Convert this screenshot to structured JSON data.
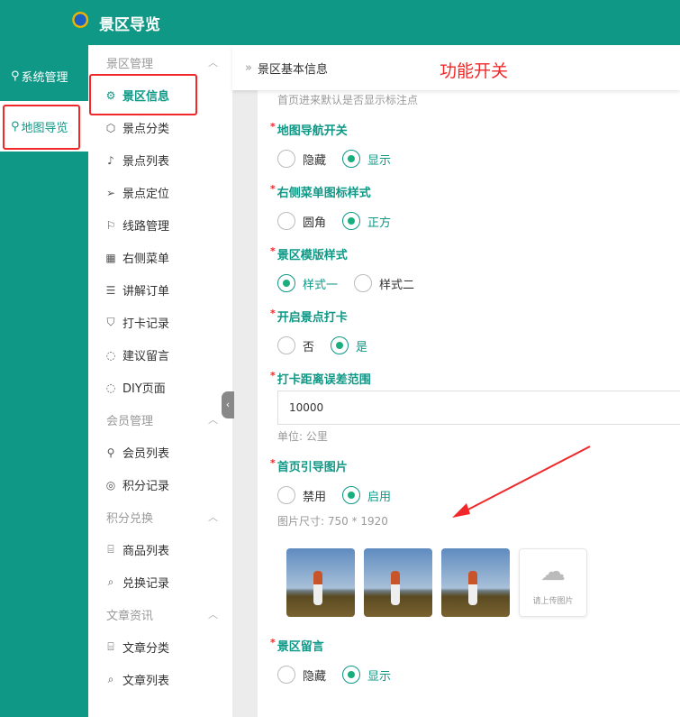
{
  "header": {
    "title": "景区导览"
  },
  "sidebar_main": {
    "items": [
      {
        "label": "系统管理",
        "icon": "user-icon"
      },
      {
        "label": "地图导览",
        "icon": "user-icon",
        "active": true
      }
    ]
  },
  "sidebar_sub": {
    "groups": [
      {
        "label": "景区管理",
        "items": [
          {
            "label": "景区信息",
            "icon": "gear-icon",
            "active": true
          },
          {
            "label": "景点分类",
            "icon": "cube-icon"
          },
          {
            "label": "景点列表",
            "icon": "music-note-icon"
          },
          {
            "label": "景点定位",
            "icon": "send-icon"
          },
          {
            "label": "线路管理",
            "icon": "flag-icon"
          },
          {
            "label": "右侧菜单",
            "icon": "grid-icon"
          },
          {
            "label": "讲解订单",
            "icon": "list-icon"
          },
          {
            "label": "打卡记录",
            "icon": "shield-icon"
          },
          {
            "label": "建议留言",
            "icon": "message-icon"
          },
          {
            "label": "DIY页面",
            "icon": "message-icon"
          }
        ]
      },
      {
        "label": "会员管理",
        "items": [
          {
            "label": "会员列表",
            "icon": "user-icon"
          },
          {
            "label": "积分记录",
            "icon": "medal-icon"
          }
        ]
      },
      {
        "label": "积分兑换",
        "items": [
          {
            "label": "商品列表",
            "icon": "gift-icon"
          },
          {
            "label": "兑换记录",
            "icon": "search-icon"
          }
        ]
      },
      {
        "label": "文章资讯",
        "items": [
          {
            "label": "文章分类",
            "icon": "gift-icon"
          },
          {
            "label": "文章列表",
            "icon": "search-icon"
          }
        ]
      }
    ]
  },
  "breadcrumb": {
    "current": "景区基本信息"
  },
  "annotation": "功能开关",
  "form": {
    "top_hint": "首页进来默认是否显示标注点",
    "map_nav": {
      "label": "地图导航开关",
      "options": [
        "隐藏",
        "显示"
      ],
      "selected": "显示"
    },
    "menu_icon": {
      "label": "右侧菜单图标样式",
      "options": [
        "圆角",
        "正方"
      ],
      "selected": "正方"
    },
    "template": {
      "label": "景区模版样式",
      "options": [
        "样式一",
        "样式二"
      ],
      "selected": "样式一"
    },
    "checkin": {
      "label": "开启景点打卡",
      "options": [
        "否",
        "是"
      ],
      "selected": "是"
    },
    "range": {
      "label": "打卡距离误差范围",
      "value": "10000",
      "unit": "单位: 公里"
    },
    "guide_image": {
      "label": "首页引导图片",
      "options": [
        "禁用",
        "启用"
      ],
      "selected": "启用",
      "size_hint": "图片尺寸: 750 * 1920",
      "upload_label": "请上传图片",
      "image_count": 3
    },
    "message": {
      "label": "景区留言",
      "options": [
        "隐藏",
        "显示"
      ],
      "selected": "显示"
    }
  },
  "colors": {
    "primary": "#0f9886",
    "annotation": "#f0282a"
  }
}
